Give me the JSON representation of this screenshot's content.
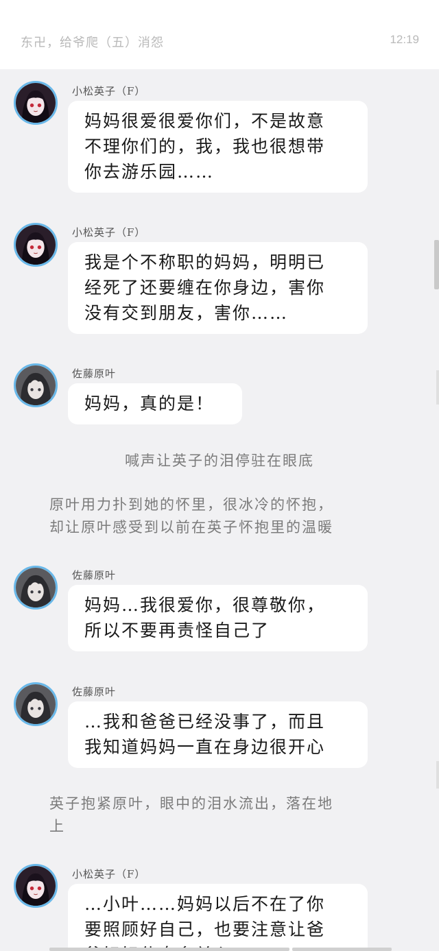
{
  "header": {
    "title": "东卍，给爷爬（五）消怨",
    "time": "12:19"
  },
  "messages": [
    {
      "speaker": "小松英子（F）",
      "lines": [
        "妈妈很爱很爱你们，不是故意",
        "不理你们的，我，我也很想带",
        "你去游乐园……"
      ],
      "avatar": "eiko-avatar"
    },
    {
      "speaker": "小松英子（F）",
      "lines": [
        "我是个不称职的妈妈，明明已",
        "经死了还要缠在你身边，害你",
        "没有交到朋友，害你……"
      ],
      "avatar": "eiko-avatar"
    },
    {
      "speaker": "佐藤原叶",
      "lines": [
        "妈妈，真的是！"
      ],
      "avatar": "haraha-avatar"
    },
    {
      "speaker": "佐藤原叶",
      "lines": [
        "妈妈…我很爱你，很尊敬你，",
        "所以不要再责怪自己了"
      ],
      "avatar": "haraha-avatar"
    },
    {
      "speaker": "佐藤原叶",
      "lines": [
        "…我和爸爸已经没事了，而且",
        "我知道妈妈一直在身边很开心"
      ],
      "avatar": "haraha-avatar"
    },
    {
      "speaker": "小松英子（F）",
      "lines": [
        "…小叶……妈妈以后不在了你",
        "要照顾好自己，也要注意让爸",
        "爸好好休息多关心"
      ],
      "avatar": "eiko-avatar"
    }
  ],
  "narrations": [
    {
      "lines": [
        "喊声让英子的泪停驻在眼底"
      ]
    },
    {
      "lines": [
        "原叶用力扑到她的怀里，很冰冷的怀抱，",
        "却让原叶感受到以前在英子怀抱里的温暖"
      ]
    },
    {
      "lines": [
        "英子抱紧原叶，眼中的泪水流出，落在地",
        "上"
      ]
    }
  ]
}
